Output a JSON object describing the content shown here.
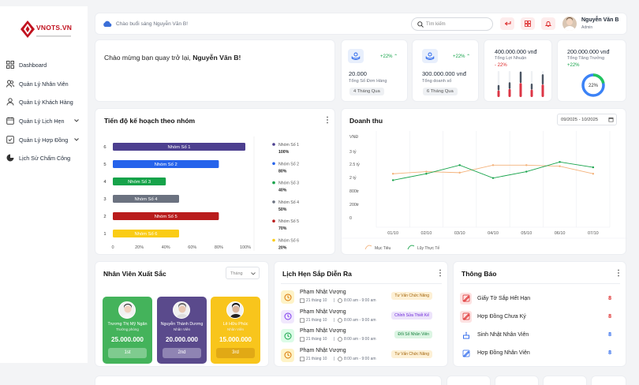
{
  "brand": {
    "name": "VNOTS.VN"
  },
  "nav": [
    {
      "label": "Dashboard",
      "icon": "grid-icon",
      "expand": false
    },
    {
      "label": "Quản Lý Nhân Viên",
      "icon": "users-icon",
      "expand": false
    },
    {
      "label": "Quản Lý Khách Hàng",
      "icon": "user-icon",
      "expand": false
    },
    {
      "label": "Quản Lý Lịch Hẹn",
      "icon": "calendar-icon",
      "expand": true
    },
    {
      "label": "Quản Lý Hợp Đồng",
      "icon": "contract-icon",
      "expand": true
    },
    {
      "label": "Lịch Sử Chấm Công",
      "icon": "history-icon",
      "expand": false
    }
  ],
  "topbar": {
    "greeting": "Chào buổi sáng Nguyễn Văn B!",
    "search_placeholder": "Tìm kiếm",
    "user_name": "Nguyễn Văn B",
    "user_role": "Admin"
  },
  "welcome": {
    "prefix": "Chào mừng bạn quay trở lại, ",
    "name": "Nguyễn Văn B!"
  },
  "stats": [
    {
      "value": "20.000",
      "label": "Tổng Số Đơn Hàng",
      "change": "+22% ⌃",
      "period": "4 Tháng Qua"
    },
    {
      "value": "300.000.000 vnđ",
      "label": "Tổng doanh số",
      "change": "+22% ⌃",
      "period": "6 Tháng Qua"
    }
  ],
  "profit": {
    "value": "400.000.000 vnđ",
    "label": "Tổng Lợi Nhuận",
    "change": "- 22%",
    "bars": [
      0.45,
      0.55,
      0.95,
      0.5,
      0.85
    ]
  },
  "growth": {
    "value": "200.000.000 vnđ",
    "label": "Tổng Tăng Trưởng",
    "change": "+22%",
    "percent": 22,
    "percent_label": "22%"
  },
  "progress": {
    "title": "Tiến độ kế hoạch theo nhóm",
    "chart_data": {
      "type": "bar",
      "orientation": "horizontal",
      "categories": [
        "6",
        "5",
        "4",
        "3",
        "2",
        "1"
      ],
      "labels": [
        "Nhóm Số 1",
        "Nhóm Số 2",
        "Nhóm Số 3",
        "Nhóm Số 4",
        "Nhóm Số 5",
        "Nhóm Số 6"
      ],
      "values": [
        100,
        80,
        40,
        50,
        80,
        50
      ],
      "colors": [
        "#4c3f8f",
        "#2563eb",
        "#16a34a",
        "#6b7280",
        "#b91c1c",
        "#facc15"
      ],
      "xticks": [
        "0",
        "20%",
        "40%",
        "60%",
        "80%",
        "100%"
      ],
      "xlim": [
        0,
        100
      ],
      "legend": [
        {
          "name": "Nhóm Số 1",
          "value": "100%",
          "color": "#4c3f8f"
        },
        {
          "name": "Nhóm Số 2",
          "value": "80%",
          "color": "#2563eb"
        },
        {
          "name": "Nhóm Số 3",
          "value": "40%",
          "color": "#16a34a"
        },
        {
          "name": "Nhóm Số 4",
          "value": "50%",
          "color": "#6b7280"
        },
        {
          "name": "Nhóm Số 5",
          "value": "70%",
          "color": "#b91c1c"
        },
        {
          "name": "Nhóm Số 6",
          "value": "20%",
          "color": "#facc15"
        }
      ]
    }
  },
  "revenue": {
    "title": "Doanh thu",
    "date_range": "09/2025 - 10/2025",
    "chart_data": {
      "type": "line",
      "ylabel": "VNĐ",
      "yticks": [
        "3 tỷ",
        "2.5 tỷ",
        "2 tỷ",
        "800tr",
        "200tr",
        "0"
      ],
      "x": [
        "01/10",
        "02/10",
        "03/10",
        "04/10",
        "05/10",
        "06/10",
        "07/10"
      ],
      "series": [
        {
          "name": "Mục Tiêu",
          "color": "#f4b27a",
          "values": [
            2.05,
            2.15,
            2.1,
            2.45,
            2.45,
            2.4,
            2.05
          ]
        },
        {
          "name": "Lũy Thực Tế",
          "color": "#16a34a",
          "values": [
            1.75,
            2.05,
            2.45,
            1.85,
            2.15,
            2.6,
            2.35
          ]
        }
      ]
    }
  },
  "employees": {
    "title": "Nhân Viên Xuất Sắc",
    "period": "Tháng",
    "list": [
      {
        "name": "Trương Thị Mỹ Ngân",
        "role": "Trưởng phòng",
        "amount": "25.000.000",
        "rank": "1st"
      },
      {
        "name": "Nguyễn Thành Dương",
        "role": "Nhân Viên",
        "amount": "20.000.000",
        "rank": "2nd"
      },
      {
        "name": "Lê Hữu Phúc",
        "role": "Nhân Viên",
        "amount": "15.000.000",
        "rank": "3rd"
      }
    ]
  },
  "appointments": {
    "title": "Lịch Hẹn Sắp Diễn Ra",
    "list": [
      {
        "name": "Phạm Nhật Vượng",
        "date": "21 tháng 10",
        "time": "8:00 am - 9:00 am",
        "tag": "Tư Vấn Chức Năng",
        "tag_bg": "#fdf0d5",
        "tag_fg": "#a16207",
        "icon_bg": "#fef3c7",
        "icon_fg": "#d97706"
      },
      {
        "name": "Phạm Nhật Vượng",
        "date": "21 tháng 10",
        "time": "8:00 am - 9:00 am",
        "tag": "Chỉnh Sửa Thiết Kế",
        "tag_bg": "#ede4fb",
        "tag_fg": "#6d28d9",
        "icon_bg": "#f1e8fd",
        "icon_fg": "#7c3aed"
      },
      {
        "name": "Phạm Nhật Vượng",
        "date": "21 tháng 10",
        "time": "8:00 am - 9:00 am",
        "tag": "Đổi Số Nhân Viên",
        "tag_bg": "#dcf5e3",
        "tag_fg": "#15803d",
        "icon_bg": "#dcfce7",
        "icon_fg": "#16a34a"
      },
      {
        "name": "Phạm Nhật Vượng",
        "date": "21 tháng 10",
        "time": "8:00 am - 9:00 am",
        "tag": "Tư Vấn Chức Năng",
        "tag_bg": "#fdf0d5",
        "tag_fg": "#a16207",
        "icon_bg": "#fef3c7",
        "icon_fg": "#d97706"
      }
    ]
  },
  "notifications": {
    "title": "Thông Báo",
    "list": [
      {
        "label": "Giấy Tờ Sắp Hết Hạn",
        "count": "8",
        "color": "#dc2626",
        "bg": "#fde2e2",
        "icon": "edit-icon"
      },
      {
        "label": "Hợp Đồng Chưa Ký",
        "count": "8",
        "color": "#dc2626",
        "bg": "#fde2e2",
        "icon": "edit-icon"
      },
      {
        "label": "Sinh Nhật Nhân Viên",
        "count": "8",
        "color": "#2563eb",
        "bg": "#ffffff",
        "icon": "cake-icon"
      },
      {
        "label": "Hợp Đồng Nhân Viên",
        "count": "8",
        "color": "#2563eb",
        "bg": "#ffffff",
        "icon": "edit-icon"
      }
    ]
  }
}
